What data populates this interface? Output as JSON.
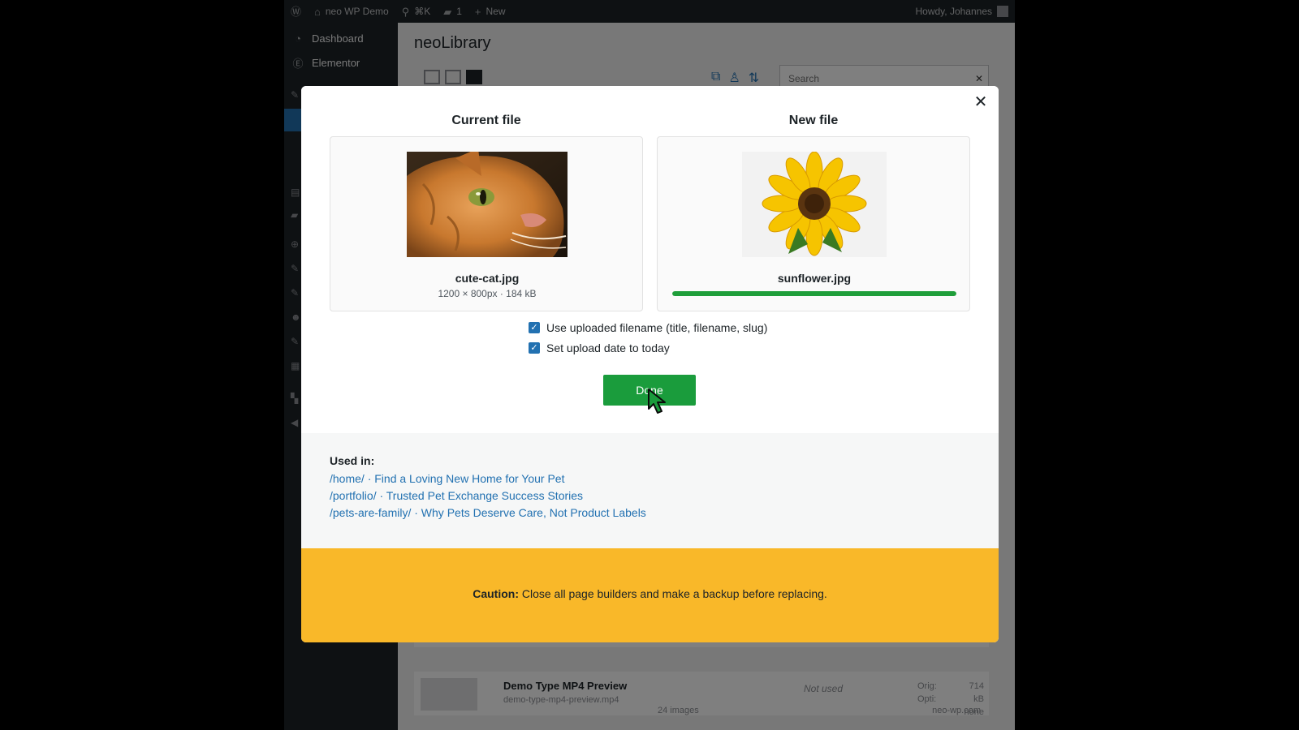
{
  "adminbar": {
    "site_name": "neo WP Demo",
    "shortcut": "⌘K",
    "comments_count": "1",
    "new_label": "New",
    "greeting": "Howdy, Johannes"
  },
  "sidebar": {
    "items": [
      {
        "label": "Dashboard",
        "icon": "dashboard-icon"
      },
      {
        "label": "Elementor",
        "icon": "elementor-icon"
      }
    ]
  },
  "content": {
    "title": "neoLibrary",
    "search_placeholder": "Search",
    "rows": [
      {
        "title": "Demo Type MP4 Preview",
        "subtitle": "demo-type-mp4-preview.mp4",
        "status": "Not used",
        "meta_labels": [
          "Orig:",
          "Opti:"
        ],
        "meta_values": [
          "714 kB",
          "none"
        ]
      }
    ],
    "footer_count": "24 images",
    "footer_site": "neo-wp.com"
  },
  "modal": {
    "current_title": "Current file",
    "new_title": "New file",
    "current_file": {
      "name": "cute-cat.jpg",
      "meta": "1200 × 800px · 184 kB"
    },
    "new_file": {
      "name": "sunflower.jpg",
      "progress": 1.0
    },
    "options": [
      {
        "label": "Use uploaded filename (title, filename, slug)",
        "checked": true
      },
      {
        "label": "Set upload date to today",
        "checked": true
      }
    ],
    "done_label": "Done",
    "used_in_label": "Used in:",
    "used_in": [
      "/home/ · Find a Loving New Home for Your Pet",
      "/portfolio/ · Trusted Pet Exchange Success Stories",
      "/pets-are-family/ · Why Pets Deserve Care, Not Product Labels"
    ],
    "caution_label": "Caution:",
    "caution_text": "Close all page builders and make a backup before replacing."
  },
  "colors": {
    "accent": "#2271b1",
    "done": "#1a9c3c",
    "caution": "#f9b829"
  }
}
